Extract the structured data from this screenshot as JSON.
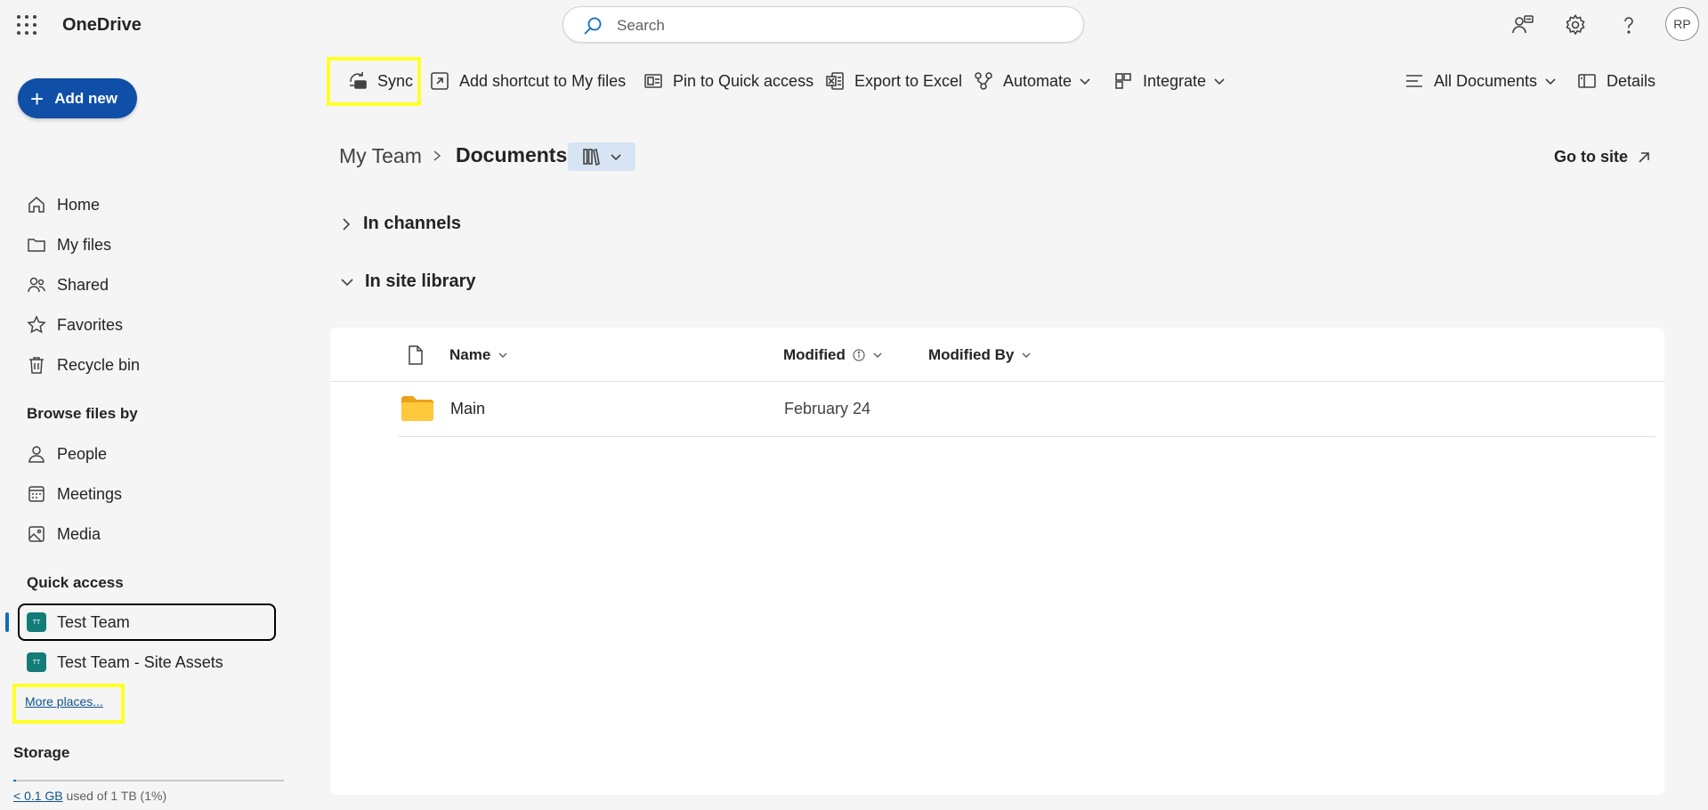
{
  "app": {
    "title": "OneDrive",
    "avatar_initials": "RP"
  },
  "search": {
    "placeholder": "Search"
  },
  "top_icons": [
    "people-settings-icon",
    "gear-icon",
    "help-icon"
  ],
  "nav": {
    "add_new": "Add new",
    "items": [
      {
        "label": "Home",
        "icon": "home-icon"
      },
      {
        "label": "My files",
        "icon": "folder-icon"
      },
      {
        "label": "Shared",
        "icon": "people-icon"
      },
      {
        "label": "Favorites",
        "icon": "star-icon"
      },
      {
        "label": "Recycle bin",
        "icon": "trash-icon"
      }
    ],
    "browse_heading": "Browse files by",
    "browse_items": [
      {
        "label": "People",
        "icon": "person-icon"
      },
      {
        "label": "Meetings",
        "icon": "calendar-icon"
      },
      {
        "label": "Media",
        "icon": "image-icon"
      }
    ],
    "quick_access_heading": "Quick access",
    "quick_access": [
      {
        "label": "Test Team",
        "badge": "TT",
        "selected": true
      },
      {
        "label": "Test Team - Site Assets",
        "badge": "TT",
        "selected": false
      }
    ],
    "more_places": "More places...",
    "storage_heading": "Storage",
    "storage": {
      "used_link": "< 0.1 GB",
      "of_text": " used of 1 TB (1%)",
      "used_fraction": 0.01
    }
  },
  "commands": {
    "sync": "Sync",
    "add_shortcut": "Add shortcut to My files",
    "pin": "Pin to Quick access",
    "export": "Export to Excel",
    "automate": "Automate",
    "integrate": "Integrate",
    "view": "All Documents",
    "details": "Details"
  },
  "breadcrumb": {
    "parent": "My Team",
    "current": "Documents"
  },
  "go_to_site": "Go to site",
  "groups": {
    "channels": "In channels",
    "site_library": "In site library"
  },
  "list": {
    "columns": {
      "name": "Name",
      "modified": "Modified",
      "modified_by": "Modified By"
    },
    "rows": [
      {
        "name": "Main",
        "type": "folder",
        "modified": "February 24",
        "modified_by": ""
      }
    ]
  },
  "highlight_color": "#ffff26",
  "accent": "#0f4fa8"
}
